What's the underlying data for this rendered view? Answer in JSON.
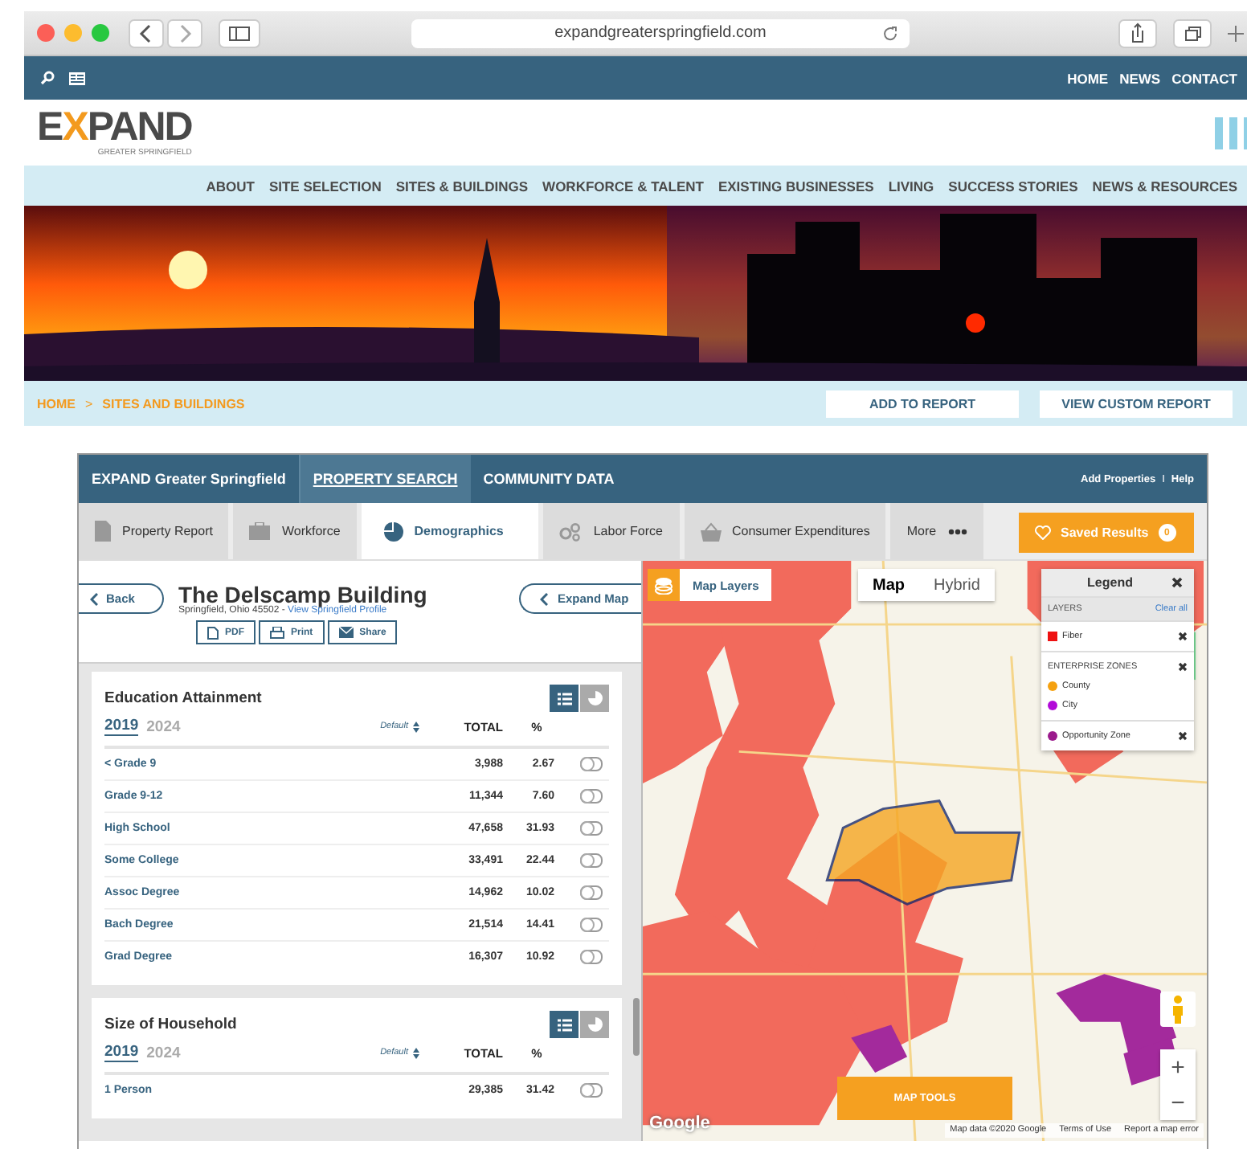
{
  "browser": {
    "url": "expandgreaterspringfield.com"
  },
  "site": {
    "utility_links": [
      "HOME",
      "NEWS",
      "CONTACT"
    ],
    "logo": {
      "word_start": "E",
      "word_x": "X",
      "word_end": "PAND",
      "tagline": "GREATER SPRINGFIELD"
    },
    "nav": [
      "ABOUT",
      "SITE SELECTION",
      "SITES & BUILDINGS",
      "WORKFORCE & TALENT",
      "EXISTING BUSINESSES",
      "LIVING",
      "SUCCESS STORIES",
      "NEWS & RESOURCES"
    ],
    "banner": {
      "kind": "picture"
    },
    "breadcrumb": {
      "items": [
        "HOME",
        "SITES AND BUILDINGS"
      ],
      "separator": ">"
    },
    "actions": [
      "ADD TO REPORT",
      "VIEW CUSTOM REPORT"
    ]
  },
  "app": {
    "brand": "EXPAND Greater Springfield",
    "header_tabs": [
      {
        "label": "PROPERTY SEARCH",
        "selected": true
      },
      {
        "label": "COMMUNITY DATA",
        "selected": false
      }
    ],
    "header_links": [
      "Add Properties",
      "Help"
    ],
    "header_separator": "I",
    "tabs": [
      {
        "label": "Property Report",
        "selected": false
      },
      {
        "label": "Workforce",
        "selected": false
      },
      {
        "label": "Demographics",
        "selected": true
      },
      {
        "label": "Labor Force",
        "selected": false
      },
      {
        "label": "Consumer Expenditures",
        "selected": false
      },
      {
        "label": "More",
        "selected": false
      }
    ],
    "saved": {
      "label": "Saved Results",
      "count": "0"
    },
    "property": {
      "back": "Back",
      "title": "The Delscamp Building",
      "address": "Springfield, Ohio 45502 - ",
      "profile_link": "View Springfield Profile",
      "actions": [
        "PDF",
        "Print",
        "Share"
      ],
      "expand": "Expand Map"
    },
    "sections": [
      {
        "title": "Education Attainment",
        "views": [
          {
            "selected": true
          },
          {
            "selected": false
          }
        ],
        "years": [
          {
            "label": "2019",
            "selected": true
          },
          {
            "label": "2024",
            "selected": false
          }
        ],
        "sort": "Default",
        "columns": [
          "TOTAL",
          "%"
        ],
        "rows": [
          {
            "label": "< Grade 9",
            "total": "3,988",
            "pct": "2.67",
            "on": false
          },
          {
            "label": "Grade 9-12",
            "total": "11,344",
            "pct": "7.60",
            "on": false
          },
          {
            "label": "High School",
            "total": "47,658",
            "pct": "31.93",
            "on": false
          },
          {
            "label": "Some College",
            "total": "33,491",
            "pct": "22.44",
            "on": false
          },
          {
            "label": "Assoc Degree",
            "total": "14,962",
            "pct": "10.02",
            "on": false
          },
          {
            "label": "Bach Degree",
            "total": "21,514",
            "pct": "14.41",
            "on": false
          },
          {
            "label": "Grad Degree",
            "total": "16,307",
            "pct": "10.92",
            "on": false
          }
        ]
      },
      {
        "title": "Size of Household",
        "views": [
          {
            "selected": true
          },
          {
            "selected": false
          }
        ],
        "years": [
          {
            "label": "2019",
            "selected": true
          },
          {
            "label": "2024",
            "selected": false
          }
        ],
        "sort": "Default",
        "columns": [
          "TOTAL",
          "%"
        ],
        "rows": [
          {
            "label": "1 Person",
            "total": "29,385",
            "pct": "31.42",
            "on": false
          }
        ]
      }
    ],
    "map": {
      "kind": "picture",
      "layers_button": "Map Layers",
      "map_types": [
        {
          "label": "Map",
          "selected": true
        },
        {
          "label": "Hybrid",
          "selected": false
        }
      ],
      "legend": {
        "title": "Legend",
        "layers_label": "LAYERS",
        "clear": "Clear all",
        "groups": [
          {
            "items": [
              {
                "label": "Fiber",
                "color": "#ee1111",
                "kind": "square"
              }
            ]
          },
          {
            "title": "ENTERPRISE ZONES",
            "items": [
              {
                "label": "County",
                "color": "#f5a10f",
                "kind": "dot"
              },
              {
                "label": "City",
                "color": "#b20ad8",
                "kind": "dot"
              }
            ]
          },
          {
            "items": [
              {
                "label": "Opportunity Zone",
                "color": "#9b1a8c",
                "kind": "dot"
              }
            ]
          }
        ]
      },
      "tools": "MAP TOOLS",
      "zoom": [
        "+",
        "−"
      ],
      "logo": "Google",
      "attribution": [
        "Map data ©2020 Google",
        "Terms of Use",
        "Report a map error"
      ]
    }
  }
}
